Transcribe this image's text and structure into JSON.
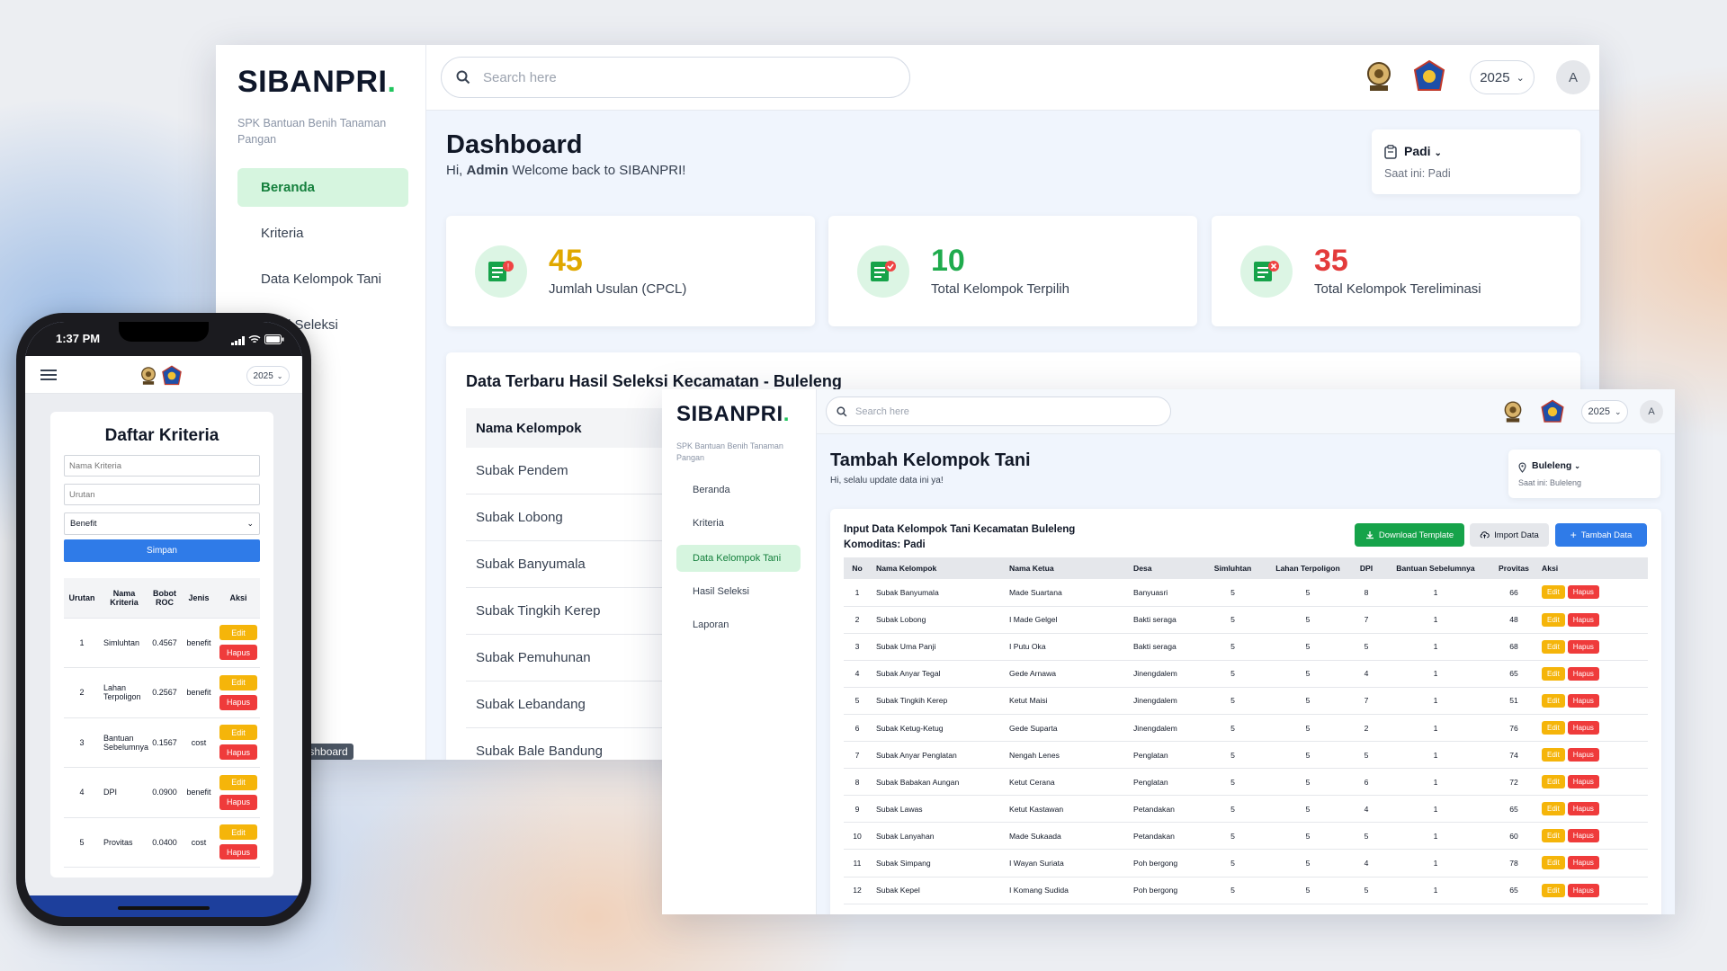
{
  "desktop": {
    "brand": "SIBANPRI",
    "brand_dot": ".",
    "brand_subtitle": "SPK Bantuan Benih Tanaman Pangan",
    "nav": [
      {
        "label": "Beranda"
      },
      {
        "label": "Kriteria"
      },
      {
        "label": "Data Kelompok Tani"
      },
      {
        "label": "Hasil Seleksi"
      }
    ],
    "search_placeholder": "Search here",
    "year": "2025",
    "avatar": "A",
    "title": "Dashboard",
    "greet_prefix": "Hi, ",
    "greet_user": "Admin",
    "greet_suffix": " Welcome back to SIBANPRI!",
    "commodity": {
      "value": "Padi",
      "note": "Saat ini: Padi"
    },
    "stats": [
      {
        "value": "45",
        "label": "Jumlah Usulan (CPCL)",
        "color": "#e0a800"
      },
      {
        "value": "10",
        "label": "Total Kelompok Terpilih",
        "color": "#1fab4d"
      },
      {
        "value": "35",
        "label": "Total Kelompok Tereliminasi",
        "color": "#e33b3b"
      }
    ],
    "latest_title": "Data Terbaru Hasil Seleksi Kecamatan - Buleleng",
    "latest_header": "Nama Kelompok",
    "latest_rows": [
      "Subak Pendem",
      "Subak Lobong",
      "Subak Banyumala",
      "Subak Tingkih Kerep",
      "Subak Pemuhunan",
      "Subak Lebandang",
      "Subak Bale Bandung"
    ],
    "tooltip": "Dashboard"
  },
  "data_window": {
    "brand": "SIBANPRI",
    "brand_dot": ".",
    "brand_subtitle": "SPK Bantuan Benih Tanaman Pangan",
    "nav": [
      {
        "label": "Beranda"
      },
      {
        "label": "Kriteria"
      },
      {
        "label": "Data Kelompok Tani"
      },
      {
        "label": "Hasil Seleksi"
      },
      {
        "label": "Laporan"
      }
    ],
    "search_placeholder": "Search here",
    "year": "2025",
    "avatar": "A",
    "title": "Tambah Kelompok Tani",
    "subtitle": "Hi, selalu update data ini ya!",
    "location": {
      "value": "Buleleng",
      "note": "Saat ini: Buleleng"
    },
    "card_title": "Input Data Kelompok Tani Kecamatan Buleleng",
    "card_commodity": "Komoditas: Padi",
    "btn_download": "Download Template",
    "btn_import": "Import Data",
    "btn_add": "Tambah Data",
    "columns": [
      "No",
      "Nama Kelompok",
      "Nama Ketua",
      "Desa",
      "Simluhtan",
      "Lahan Terpoligon",
      "DPI",
      "Bantuan Sebelumnya",
      "Provitas",
      "Aksi"
    ],
    "edit_label": "Edit",
    "delete_label": "Hapus",
    "rows": [
      [
        "1",
        "Subak Banyumala",
        "Made Suartana",
        "Banyuasri",
        "5",
        "5",
        "8",
        "1",
        "66"
      ],
      [
        "2",
        "Subak Lobong",
        "I Made Gelgel",
        "Bakti seraga",
        "5",
        "5",
        "7",
        "1",
        "48"
      ],
      [
        "3",
        "Subak Uma Panji",
        "I Putu Oka",
        "Bakti seraga",
        "5",
        "5",
        "5",
        "1",
        "68"
      ],
      [
        "4",
        "Subak Anyar Tegal",
        "Gede Arnawa",
        "Jinengdalem",
        "5",
        "5",
        "4",
        "1",
        "65"
      ],
      [
        "5",
        "Subak Tingkih Kerep",
        "Ketut Maisi",
        "Jinengdalem",
        "5",
        "5",
        "7",
        "1",
        "51"
      ],
      [
        "6",
        "Subak Ketug-Ketug",
        "Gede Suparta",
        "Jinengdalem",
        "5",
        "5",
        "2",
        "1",
        "76"
      ],
      [
        "7",
        "Subak Anyar Penglatan",
        "Nengah Lenes",
        "Penglatan",
        "5",
        "5",
        "5",
        "1",
        "74"
      ],
      [
        "8",
        "Subak Babakan Aungan",
        "Ketut Cerana",
        "Penglatan",
        "5",
        "5",
        "6",
        "1",
        "72"
      ],
      [
        "9",
        "Subak Lawas",
        "Ketut Kastawan",
        "Petandakan",
        "5",
        "5",
        "4",
        "1",
        "65"
      ],
      [
        "10",
        "Subak Lanyahan",
        "Made Sukaada",
        "Petandakan",
        "5",
        "5",
        "5",
        "1",
        "60"
      ],
      [
        "11",
        "Subak Simpang",
        "I Wayan Suriata",
        "Poh bergong",
        "5",
        "5",
        "4",
        "1",
        "78"
      ],
      [
        "12",
        "Subak Kepel",
        "I Komang Sudida",
        "Poh bergong",
        "5",
        "5",
        "5",
        "1",
        "65"
      ]
    ]
  },
  "phone": {
    "time": "1:37 PM",
    "year": "2025",
    "title": "Daftar Kriteria",
    "name_placeholder": "Nama Kriteria",
    "order_placeholder": "Urutan",
    "type_selected": "Benefit",
    "save": "Simpan",
    "columns": [
      "Urutan",
      "Nama Kriteria",
      "Bobot ROC",
      "Jenis",
      "Aksi"
    ],
    "edit_label": "Edit",
    "delete_label": "Hapus",
    "rows": [
      [
        "1",
        "Simluhtan",
        "0.4567",
        "benefit"
      ],
      [
        "2",
        "Lahan Terpoligon",
        "0.2567",
        "benefit"
      ],
      [
        "3",
        "Bantuan Sebelumnya",
        "0.1567",
        "cost"
      ],
      [
        "4",
        "DPI",
        "0.0900",
        "benefit"
      ],
      [
        "5",
        "Provitas",
        "0.0400",
        "cost"
      ]
    ]
  },
  "colors": {
    "accent_green": "#22c55e",
    "primary_blue": "#2f7be8",
    "edit_yellow": "#f5b50a",
    "delete_red": "#ef3b3b"
  }
}
